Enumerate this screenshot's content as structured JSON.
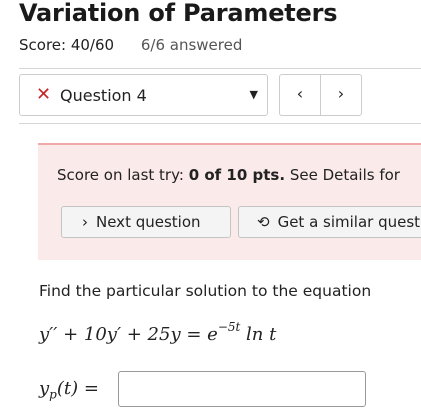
{
  "header": {
    "title": "Variation of Parameters",
    "score": "Score: 40/60",
    "answered": "6/6 answered"
  },
  "question_nav": {
    "status_icon": "x-icon",
    "status_symbol": "✕",
    "selected_question": "Question 4",
    "caret": "▼",
    "prev_symbol": "‹",
    "next_symbol": "›"
  },
  "alert": {
    "prefix": "Score on last try: ",
    "score": "0 of 10 pts.",
    "suffix": " See Details for",
    "next_button_icon": "›",
    "next_button_label": "Next question",
    "similar_button_icon": "⟲",
    "similar_button_label": "Get a similar question"
  },
  "problem": {
    "prompt": "Find the particular solution to the equation",
    "equation_lhs": "y′′ + 10y′ + 25y = e",
    "equation_exp": "−5t",
    "equation_rhs": " ln t",
    "answer_var": "y",
    "answer_sub": "p",
    "answer_rest": "(t) =",
    "answer_value": ""
  },
  "colors": {
    "error_red": "#c62828",
    "alert_background": "#fbeaea",
    "alert_border": "#f0a8a8"
  }
}
